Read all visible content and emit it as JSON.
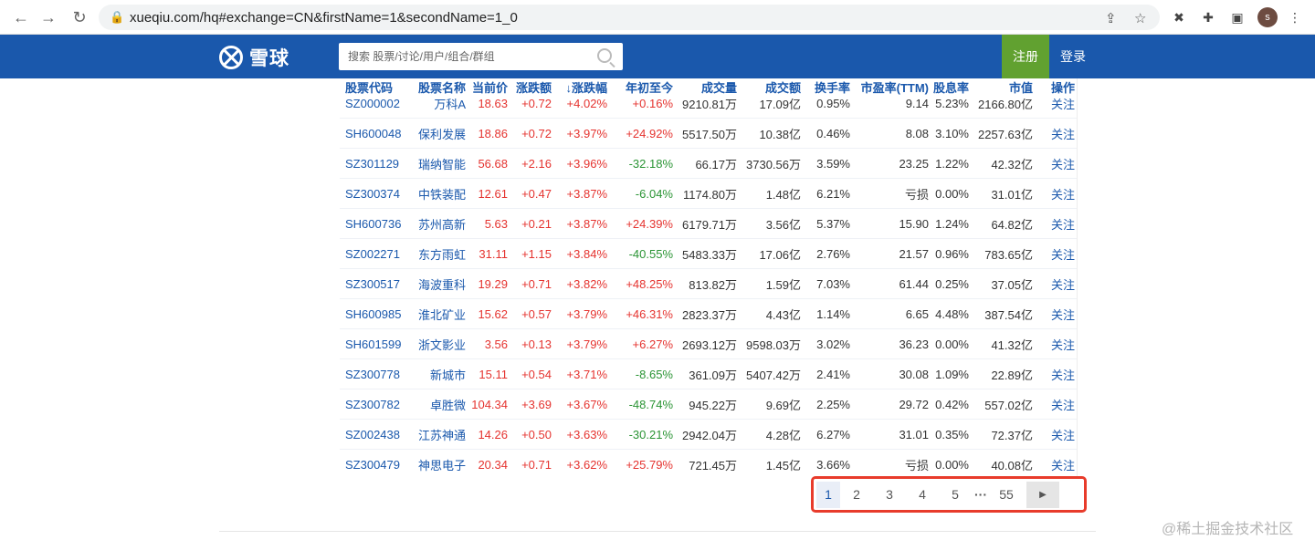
{
  "browser": {
    "url": "xueqiu.com/hq#exchange=CN&firstName=1&secondName=1_0",
    "avatar_letter": "s"
  },
  "header": {
    "logo_text": "雪球",
    "search_placeholder": "搜索 股票/讨论/用户/组合/群组",
    "register_label": "注册",
    "login_label": "登录"
  },
  "table": {
    "columns": [
      "股票代码",
      "股票名称",
      "当前价",
      "涨跌额",
      "↓涨跌幅",
      "年初至今",
      "成交量",
      "成交额",
      "换手率",
      "市盈率(TTM)",
      "股息率",
      "市值",
      "操作"
    ],
    "rows": [
      {
        "code": "SZ000002",
        "name": "万科A",
        "price": "18.63",
        "chg": "+0.72",
        "pct": "+4.02%",
        "ytd": "+0.16%",
        "vol": "9210.81万",
        "amt": "17.09亿",
        "turn": "0.95%",
        "pe": "9.14",
        "div": "5.23%",
        "cap": "2166.80亿",
        "act": "关注"
      },
      {
        "code": "SH600048",
        "name": "保利发展",
        "price": "18.86",
        "chg": "+0.72",
        "pct": "+3.97%",
        "ytd": "+24.92%",
        "vol": "5517.50万",
        "amt": "10.38亿",
        "turn": "0.46%",
        "pe": "8.08",
        "div": "3.10%",
        "cap": "2257.63亿",
        "act": "关注"
      },
      {
        "code": "SZ301129",
        "name": "瑞纳智能",
        "price": "56.68",
        "chg": "+2.16",
        "pct": "+3.96%",
        "ytd": "-32.18%",
        "vol": "66.17万",
        "amt": "3730.56万",
        "turn": "3.59%",
        "pe": "23.25",
        "div": "1.22%",
        "cap": "42.32亿",
        "act": "关注"
      },
      {
        "code": "SZ300374",
        "name": "中铁装配",
        "price": "12.61",
        "chg": "+0.47",
        "pct": "+3.87%",
        "ytd": "-6.04%",
        "vol": "1174.80万",
        "amt": "1.48亿",
        "turn": "6.21%",
        "pe": "亏损",
        "div": "0.00%",
        "cap": "31.01亿",
        "act": "关注"
      },
      {
        "code": "SH600736",
        "name": "苏州高新",
        "price": "5.63",
        "chg": "+0.21",
        "pct": "+3.87%",
        "ytd": "+24.39%",
        "vol": "6179.71万",
        "amt": "3.56亿",
        "turn": "5.37%",
        "pe": "15.90",
        "div": "1.24%",
        "cap": "64.82亿",
        "act": "关注"
      },
      {
        "code": "SZ002271",
        "name": "东方雨虹",
        "price": "31.11",
        "chg": "+1.15",
        "pct": "+3.84%",
        "ytd": "-40.55%",
        "vol": "5483.33万",
        "amt": "17.06亿",
        "turn": "2.76%",
        "pe": "21.57",
        "div": "0.96%",
        "cap": "783.65亿",
        "act": "关注"
      },
      {
        "code": "SZ300517",
        "name": "海波重科",
        "price": "19.29",
        "chg": "+0.71",
        "pct": "+3.82%",
        "ytd": "+48.25%",
        "vol": "813.82万",
        "amt": "1.59亿",
        "turn": "7.03%",
        "pe": "61.44",
        "div": "0.25%",
        "cap": "37.05亿",
        "act": "关注"
      },
      {
        "code": "SH600985",
        "name": "淮北矿业",
        "price": "15.62",
        "chg": "+0.57",
        "pct": "+3.79%",
        "ytd": "+46.31%",
        "vol": "2823.37万",
        "amt": "4.43亿",
        "turn": "1.14%",
        "pe": "6.65",
        "div": "4.48%",
        "cap": "387.54亿",
        "act": "关注"
      },
      {
        "code": "SH601599",
        "name": "浙文影业",
        "price": "3.56",
        "chg": "+0.13",
        "pct": "+3.79%",
        "ytd": "+6.27%",
        "vol": "2693.12万",
        "amt": "9598.03万",
        "turn": "3.02%",
        "pe": "36.23",
        "div": "0.00%",
        "cap": "41.32亿",
        "act": "关注"
      },
      {
        "code": "SZ300778",
        "name": "新城市",
        "price": "15.11",
        "chg": "+0.54",
        "pct": "+3.71%",
        "ytd": "-8.65%",
        "vol": "361.09万",
        "amt": "5407.42万",
        "turn": "2.41%",
        "pe": "30.08",
        "div": "1.09%",
        "cap": "22.89亿",
        "act": "关注"
      },
      {
        "code": "SZ300782",
        "name": "卓胜微",
        "price": "104.34",
        "chg": "+3.69",
        "pct": "+3.67%",
        "ytd": "-48.74%",
        "vol": "945.22万",
        "amt": "9.69亿",
        "turn": "2.25%",
        "pe": "29.72",
        "div": "0.42%",
        "cap": "557.02亿",
        "act": "关注"
      },
      {
        "code": "SZ002438",
        "name": "江苏神通",
        "price": "14.26",
        "chg": "+0.50",
        "pct": "+3.63%",
        "ytd": "-30.21%",
        "vol": "2942.04万",
        "amt": "4.28亿",
        "turn": "6.27%",
        "pe": "31.01",
        "div": "0.35%",
        "cap": "72.37亿",
        "act": "关注"
      },
      {
        "code": "SZ300479",
        "name": "神思电子",
        "price": "20.34",
        "chg": "+0.71",
        "pct": "+3.62%",
        "ytd": "+25.79%",
        "vol": "721.45万",
        "amt": "1.45亿",
        "turn": "3.66%",
        "pe": "亏损",
        "div": "0.00%",
        "cap": "40.08亿",
        "act": "关注"
      }
    ]
  },
  "pagination": {
    "pages": [
      "1",
      "2",
      "3",
      "4",
      "5"
    ],
    "ellipsis": "···",
    "last_page": "55",
    "next": "▶"
  },
  "watermark": "@稀土掘金技术社区",
  "colors": {
    "header_bg": "#1a58ac",
    "register_bg": "#61a130",
    "up": "#e5332f",
    "down": "#2a9434",
    "highlight_box": "#e83b2b"
  }
}
